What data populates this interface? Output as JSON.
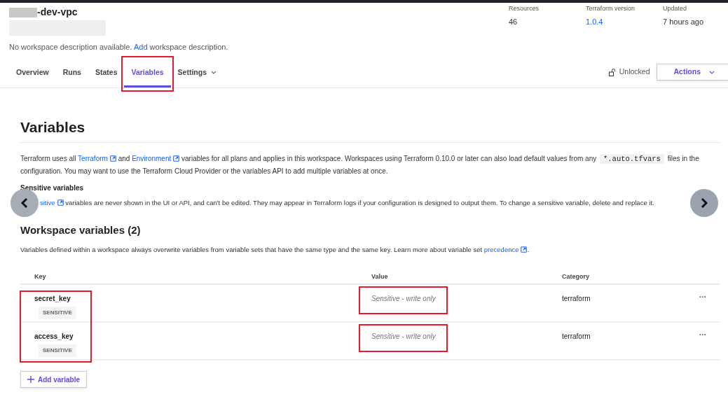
{
  "workspace": {
    "title": "-dev-vpc",
    "description": [
      {
        "kind": "text",
        "text": "No workspace description available. "
      },
      {
        "kind": "link",
        "text": "Add"
      },
      {
        "kind": "text",
        "text": " workspace description."
      }
    ]
  },
  "stats": [
    {
      "label": "Resources",
      "value": "46",
      "kind": "text"
    },
    {
      "label": "Terraform version",
      "value": "1.0.4",
      "kind": "link"
    },
    {
      "label": "Updated",
      "value": "7 hours ago",
      "kind": "text"
    }
  ],
  "tabs": [
    {
      "label": "Overview",
      "selected": false,
      "highlighted": false,
      "dropdown": false
    },
    {
      "label": "Runs",
      "selected": false,
      "highlighted": false,
      "dropdown": false
    },
    {
      "label": "States",
      "selected": false,
      "highlighted": false,
      "dropdown": false
    },
    {
      "label": "Variables",
      "selected": true,
      "highlighted": true,
      "dropdown": false
    },
    {
      "label": "Settings",
      "selected": false,
      "highlighted": false,
      "dropdown": true
    }
  ],
  "lock": {
    "label": "Unlocked",
    "locked": false
  },
  "actions_button": "Actions",
  "page_title": "Variables",
  "intro": [
    {
      "kind": "text",
      "text": "Terraform uses all "
    },
    {
      "kind": "link",
      "text": "Terraform"
    },
    {
      "kind": "text",
      "text": " and "
    },
    {
      "kind": "link",
      "text": "Environment"
    },
    {
      "kind": "text",
      "text": " variables for all plans and applies in this workspace. Workspaces using Terraform 0.10.0 or later can also load default values from any "
    },
    {
      "kind": "code",
      "text": "*.auto.tfvars"
    },
    {
      "kind": "text",
      "text": " files in the configuration. You may want to use the Terraform Cloud Provider or the variables API to add multiple variables at once."
    }
  ],
  "sensitive_heading": "Sensitive variables",
  "sensitive_text": [
    {
      "kind": "link",
      "text": "sitive"
    },
    {
      "kind": "text",
      "text": " variables are never shown in the UI or API, and can't be edited. They may appear in Terraform logs if your configuration is designed to output them. To change a sensitive variable, delete and replace it."
    }
  ],
  "workspace_variables": {
    "title": "Workspace variables (2)",
    "description": [
      {
        "kind": "text",
        "text": "Variables defined within a workspace always overwrite variables from variable sets that have the same type and the same key. Learn more about variable set "
      },
      {
        "kind": "link",
        "text": "precedence"
      },
      {
        "kind": "text",
        "text": "."
      }
    ],
    "columns": [
      "Key",
      "Value",
      "Category"
    ],
    "key_column_highlighted": true,
    "rows": [
      {
        "key": "secret_key",
        "badge": "SENSITIVE",
        "value": "Sensitive - write only",
        "value_highlighted": true,
        "category": "terraform",
        "menu": "···"
      },
      {
        "key": "access_key",
        "badge": "SENSITIVE",
        "value": "Sensitive - write only",
        "value_highlighted": true,
        "category": "terraform",
        "menu": "···"
      }
    ],
    "add_button": "Add variable"
  }
}
